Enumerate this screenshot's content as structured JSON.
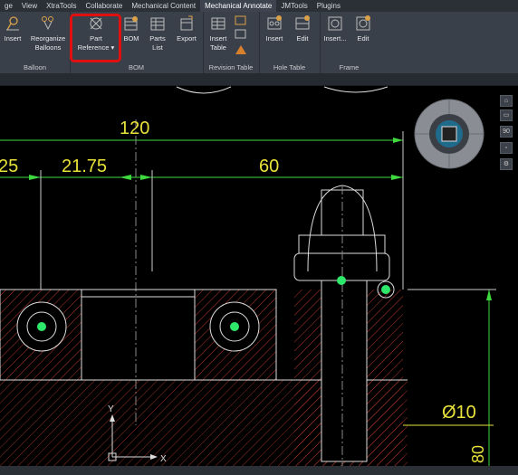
{
  "menubar": {
    "items": [
      {
        "label": "ge"
      },
      {
        "label": "View"
      },
      {
        "label": "XtraTools"
      },
      {
        "label": "Collaborate"
      },
      {
        "label": "Mechanical Content"
      },
      {
        "label": "Mechanical Annotate",
        "active": true
      },
      {
        "label": "JMTools"
      },
      {
        "label": "Plugins"
      }
    ]
  },
  "ribbon": {
    "groups": {
      "balloon": "Balloon",
      "bom": "BOM",
      "revision_table": "Revision Table",
      "hole_table": "Hole Table",
      "frame": "Frame"
    },
    "tools": {
      "insert_balloon": "Insert",
      "reorganize_1": "Reorganize",
      "reorganize_2": "Balloons",
      "part_ref_1": "Part",
      "part_ref_2": "Reference ▾",
      "bom": "BOM",
      "parts_list_1": "Parts",
      "parts_list_2": "List",
      "export": "Export",
      "insert_table_1": "Insert",
      "insert_table_2": "Table",
      "hole_insert": "Insert",
      "hole_edit": "Edit",
      "frame_insert": "Insert...",
      "frame_edit": "Edit"
    }
  },
  "drawing": {
    "dim_120": "120",
    "dim_25": "25",
    "dim_2175": "21.75",
    "dim_60": "60",
    "dim_dia10": "Ø10",
    "dim_80": "80",
    "ucs_y": "Y",
    "ucs_x": "X"
  },
  "nav": {
    "btn_90": "90"
  },
  "colors": {
    "dimension": "#e8e23a",
    "geometry": "#ffffff",
    "hatch": "#c0392b",
    "center_point": "#2ee86a",
    "dim_line": "#3fd93f",
    "highlight": "#e01010"
  }
}
